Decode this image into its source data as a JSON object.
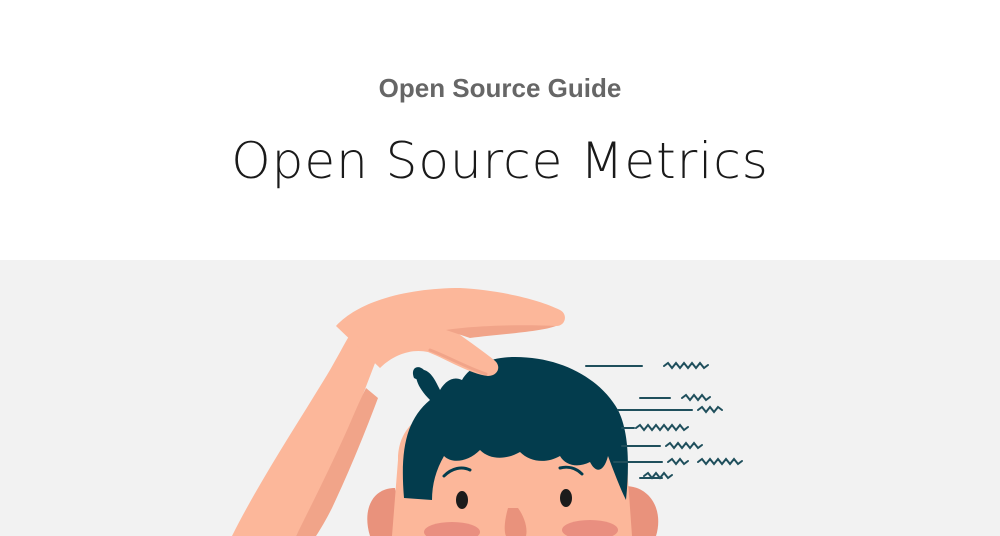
{
  "header": {
    "eyebrow": "Open Source Guide",
    "title": "Open Source Metrics"
  },
  "illustration": {
    "subject": "person-scratching-head",
    "colors": {
      "background": "#f2f2f2",
      "skin": "#fcb79a",
      "skin_shadow": "#f1a489",
      "hair": "#033c4d",
      "cheek": "#e98f80",
      "speed_lines": "#1f4f5c"
    }
  }
}
